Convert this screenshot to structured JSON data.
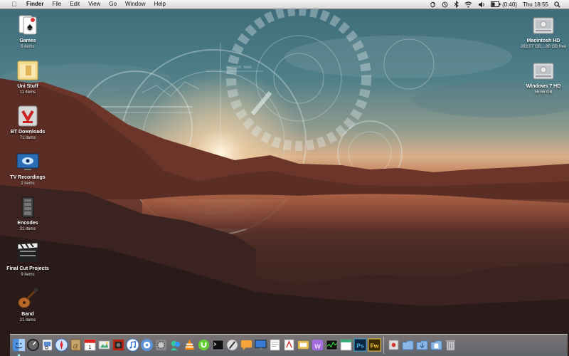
{
  "menubar": {
    "apple_glyph": "",
    "items": [
      "Finder",
      "File",
      "Edit",
      "View",
      "Go",
      "Window",
      "Help"
    ],
    "battery": "(0:40)",
    "clock": "Thu 18:55",
    "status_icons": [
      "sync-icon",
      "time-machine-icon",
      "bluetooth-icon",
      "wifi-icon",
      "volume-icon",
      "battery-icon",
      "spotlight-icon"
    ]
  },
  "desktop": {
    "left": [
      {
        "name": "Games",
        "sub": "6 items",
        "icon": "games-folder-icon"
      },
      {
        "name": "Uni Stuff",
        "sub": "11 items",
        "icon": "uni-stuff-folder-icon"
      },
      {
        "name": "BT Downloads",
        "sub": "71 items",
        "icon": "bt-downloads-folder-icon"
      },
      {
        "name": "TV Recordings",
        "sub": "2 items",
        "icon": "tv-recordings-folder-icon"
      },
      {
        "name": "Encodes",
        "sub": "31 items",
        "icon": "encodes-folder-icon"
      },
      {
        "name": "Final Cut Projects",
        "sub": "9 items",
        "icon": "final-cut-folder-icon"
      },
      {
        "name": "Band",
        "sub": "21 items",
        "icon": "band-folder-icon"
      }
    ],
    "right": [
      {
        "name": "Macintosh HD",
        "sub": "263.07 GB,...89 GB free",
        "icon": "hard-drive-icon"
      },
      {
        "name": "Windows 7 HD",
        "sub": "56.66 GB",
        "icon": "hard-drive-icon"
      }
    ]
  },
  "wallpaper_text": "0425925 5806",
  "dock": {
    "apps": [
      "finder-icon",
      "dashboard-icon",
      "preview-icon",
      "safari-icon",
      "address-book-icon",
      "ical-icon",
      "iphoto-icon",
      "photo-booth-icon",
      "itunes-icon",
      "directory-utility-icon",
      "system-preferences-icon",
      "messenger-icon",
      "vlc-icon",
      "utorrent-icon",
      "terminal-icon",
      "pen-app-icon",
      "chat-icon",
      "keynote-icon",
      "textedit-icon",
      "pdf-app-icon",
      "utility-icon",
      "web-app-icon",
      "activity-monitor-icon",
      "calendar-app-icon",
      "photoshop-icon",
      "fireworks-icon"
    ],
    "ps_label": "Ps",
    "fw_label": "Fw",
    "cal_label": "1",
    "stacks": [
      "dashboard-widget-icon",
      "applications-stack-icon",
      "downloads-stack-icon",
      "documents-stack-icon",
      "trash-icon"
    ]
  },
  "colors": {
    "menubar_bg": "#e8e8e8",
    "sky": "#4f7f89",
    "sunset": "#d8b08a",
    "ground": "#4a2a24"
  }
}
